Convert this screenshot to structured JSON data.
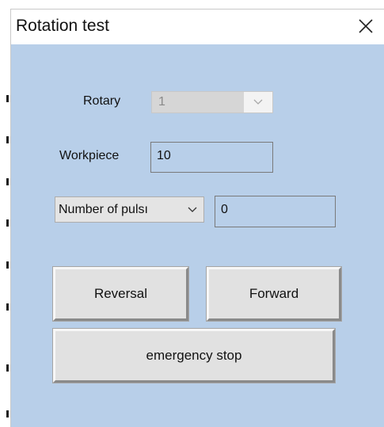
{
  "dialog": {
    "title": "Rotation test",
    "close_icon": "close-icon"
  },
  "form": {
    "rotary_label": "Rotary",
    "rotary_value": "1",
    "rotary_disabled": true,
    "workpiece_label": "Workpiece",
    "workpiece_value": "10",
    "mode_selected": "Number of pulsı",
    "pulse_value": "0"
  },
  "buttons": {
    "reversal": "Reversal",
    "forward": "Forward",
    "emergency_stop": "emergency stop"
  },
  "icons": {
    "close": "close-icon",
    "dropdown": "chevron-down-icon"
  },
  "colors": {
    "client_background": "#b8cfe9",
    "button_face": "#e1e1e1",
    "disabled_combo": "#d6d6d6"
  }
}
